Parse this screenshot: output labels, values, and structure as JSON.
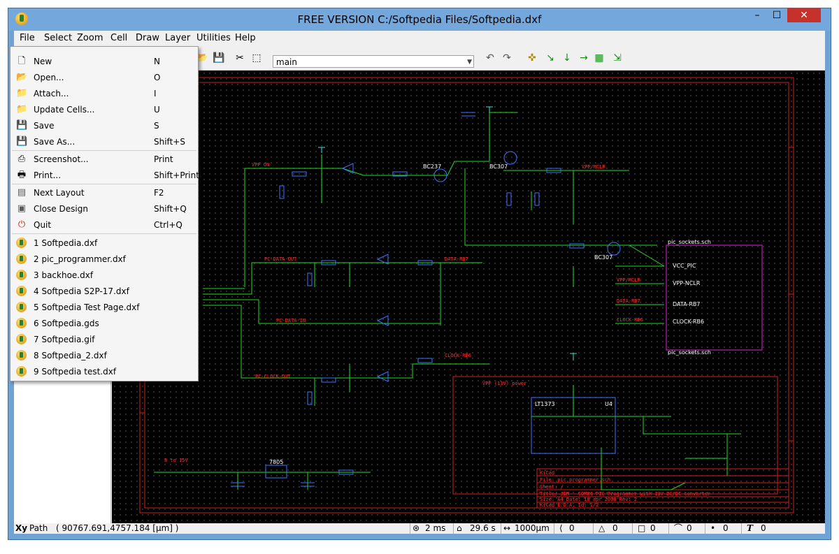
{
  "window": {
    "title": "FREE VERSION C:/Softpedia Files/Softpedia.dxf",
    "min": "–",
    "max": "☐",
    "close": "✕"
  },
  "menubar": [
    "File",
    "Select",
    "Zoom",
    "Cell",
    "Draw",
    "Layer",
    "Utilities",
    "Help"
  ],
  "toolbar": {
    "layout_combo": "main"
  },
  "file_menu": {
    "items": [
      {
        "icon": "new-file-icon",
        "label": "New",
        "shortcut": "N"
      },
      {
        "icon": "folder-open-icon",
        "label": "Open...",
        "shortcut": "O"
      },
      {
        "icon": "attach-icon",
        "label": "Attach...",
        "shortcut": "I"
      },
      {
        "icon": "update-cells-icon",
        "label": "Update Cells...",
        "shortcut": "U"
      },
      {
        "icon": "save-icon",
        "label": "Save",
        "shortcut": "S"
      },
      {
        "icon": "save-as-icon",
        "label": "Save As...",
        "shortcut": "Shift+S"
      },
      {
        "icon": "screenshot-icon",
        "label": "Screenshot...",
        "shortcut": "Print"
      },
      {
        "icon": "printer-icon",
        "label": "Print...",
        "shortcut": "Shift+Print"
      },
      {
        "icon": "next-layout-icon",
        "label": "Next Layout",
        "shortcut": "F2"
      },
      {
        "icon": "close-design-icon",
        "label": "Close Design",
        "shortcut": "Shift+Q"
      },
      {
        "icon": "quit-icon",
        "label": "Quit",
        "shortcut": "Ctrl+Q"
      }
    ],
    "recent": [
      "1 Softpedia.dxf",
      "2 pic_programmer.dxf",
      "3 backhoe.dxf",
      "4 Softpedia S2P-17.dxf",
      "5 Softpedia Test Page.dxf",
      "6 Softpedia.gds",
      "7 Softpedia.gif",
      "8 Softpedia_2.dxf",
      "9 Softpedia test.dxf"
    ]
  },
  "schematic": {
    "labels": {
      "vpp_on": "VPP_ON",
      "vpp_mclr": "VPP/MCLR",
      "pc_data_out": "PC-DATA-OUT",
      "data_rb7": "DATA-RB7",
      "pc_data_in": "PC-DATA-IN",
      "pc_clock_out": "PC-CLOCK-OUT",
      "clock_rb6": "CLOCK-RB6",
      "vpp_power": "VPP (13V) power",
      "range": "8 to 15V",
      "pic_sockets": "pic_sockets.sch",
      "vcc_pic": "VCC_PIC",
      "vpp_nclr": "VPP-NCLR",
      "data_rb7_pin": "DATA-RB7",
      "clock_rb6_pin": "CLOCK-RB6",
      "reg_7805": "7805",
      "lt1373": "LT1373",
      "u4": "U4",
      "bc237": "BC237",
      "bc307": "BC307",
      "title_block": [
        "KiCad",
        "File: pic_programmer.sch",
        "Sheet: /",
        "Title: JDM - COM84 PIC Programmer with 13V DC/DC converter",
        "Size: A4        Date: 18 apr 2008        Rev: 2",
        "KiCad E.D.A.                                  Id: 1/2"
      ]
    }
  },
  "statusbar": {
    "path_label": "Path",
    "path_value": "( 90767.691,4757.184 [µm] )",
    "time_ms": "2 ms",
    "time_s": "29.6 s",
    "grid": "1000µm",
    "counts": [
      "0",
      "0",
      "0",
      "0",
      "0",
      "0"
    ]
  },
  "colors": {
    "titlebar": "#74a8dc",
    "canvas": "#000000",
    "wire": "#22dd22",
    "component": "#3a78ff",
    "border": "#d42020",
    "sheet": "#e020e0"
  }
}
